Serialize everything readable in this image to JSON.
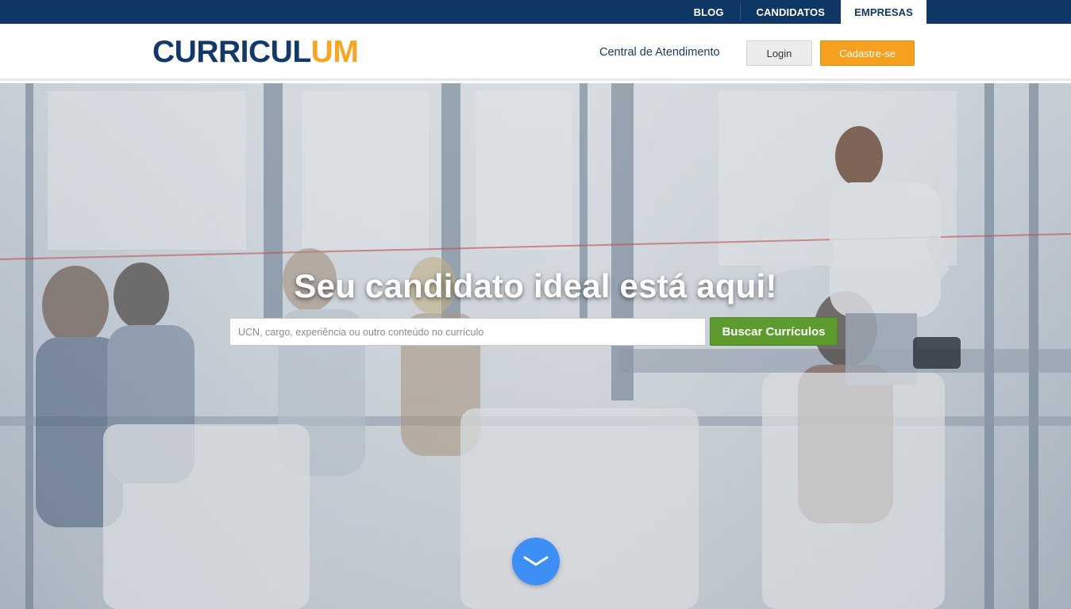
{
  "topnav": {
    "items": [
      {
        "label": "BLOG"
      },
      {
        "label": "CANDIDATOS"
      },
      {
        "label": "EMPRESAS",
        "active": true
      }
    ]
  },
  "header": {
    "logo_part1": "CURRICUL",
    "logo_part2": "UM",
    "help_link": "Central de Atendimento",
    "login_label": "Login",
    "signup_label": "Cadastre-se"
  },
  "hero": {
    "title": "Seu candidato ideal está aqui!",
    "search_placeholder": "UCN, cargo, experiência ou outro conteúdo no currículo",
    "search_value": "",
    "search_button": "Buscar Currículos",
    "scroll_icon": "chevron-down-icon"
  },
  "colors": {
    "topbar": "#0e3766",
    "brand_blue": "#12396a",
    "brand_orange": "#f5a623",
    "signup_button": "#f5a01f",
    "search_button": "#5e9b2e",
    "scroll_button": "#3d8ff5"
  }
}
